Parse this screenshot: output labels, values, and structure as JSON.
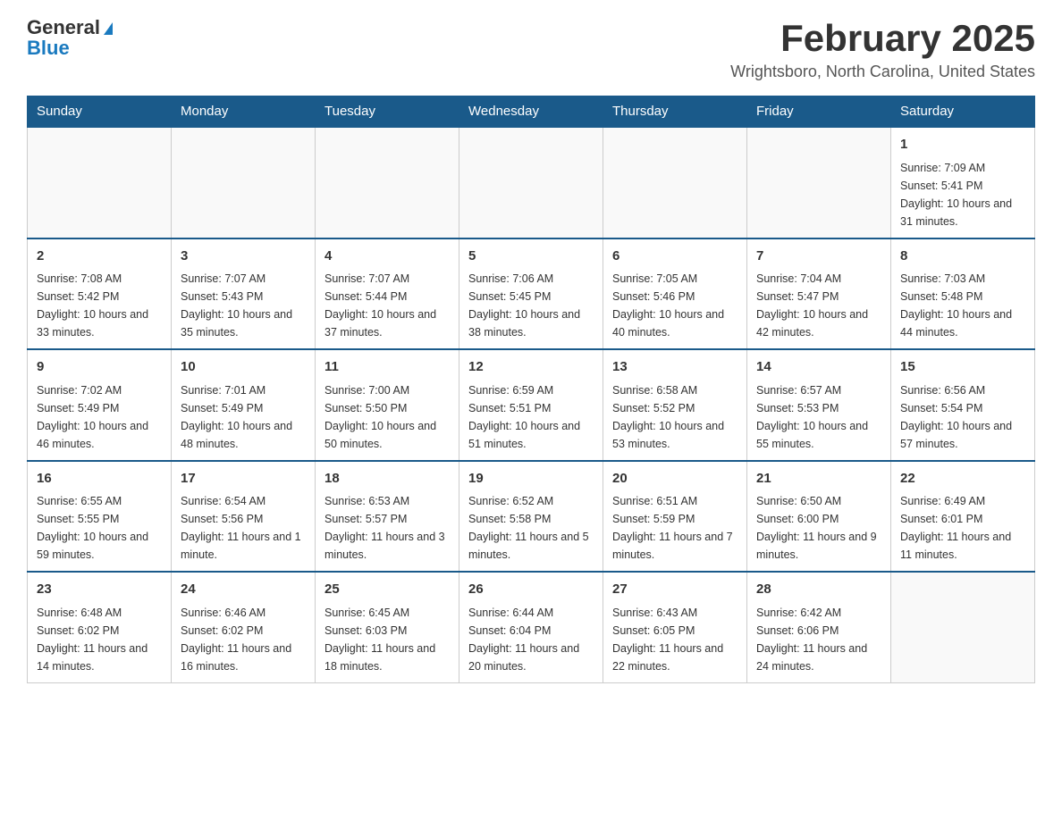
{
  "logo": {
    "general": "General",
    "blue": "Blue"
  },
  "header": {
    "month": "February 2025",
    "location": "Wrightsboro, North Carolina, United States"
  },
  "weekdays": [
    "Sunday",
    "Monday",
    "Tuesday",
    "Wednesday",
    "Thursday",
    "Friday",
    "Saturday"
  ],
  "weeks": [
    [
      {
        "day": "",
        "sunrise": "",
        "sunset": "",
        "daylight": ""
      },
      {
        "day": "",
        "sunrise": "",
        "sunset": "",
        "daylight": ""
      },
      {
        "day": "",
        "sunrise": "",
        "sunset": "",
        "daylight": ""
      },
      {
        "day": "",
        "sunrise": "",
        "sunset": "",
        "daylight": ""
      },
      {
        "day": "",
        "sunrise": "",
        "sunset": "",
        "daylight": ""
      },
      {
        "day": "",
        "sunrise": "",
        "sunset": "",
        "daylight": ""
      },
      {
        "day": "1",
        "sunrise": "Sunrise: 7:09 AM",
        "sunset": "Sunset: 5:41 PM",
        "daylight": "Daylight: 10 hours and 31 minutes."
      }
    ],
    [
      {
        "day": "2",
        "sunrise": "Sunrise: 7:08 AM",
        "sunset": "Sunset: 5:42 PM",
        "daylight": "Daylight: 10 hours and 33 minutes."
      },
      {
        "day": "3",
        "sunrise": "Sunrise: 7:07 AM",
        "sunset": "Sunset: 5:43 PM",
        "daylight": "Daylight: 10 hours and 35 minutes."
      },
      {
        "day": "4",
        "sunrise": "Sunrise: 7:07 AM",
        "sunset": "Sunset: 5:44 PM",
        "daylight": "Daylight: 10 hours and 37 minutes."
      },
      {
        "day": "5",
        "sunrise": "Sunrise: 7:06 AM",
        "sunset": "Sunset: 5:45 PM",
        "daylight": "Daylight: 10 hours and 38 minutes."
      },
      {
        "day": "6",
        "sunrise": "Sunrise: 7:05 AM",
        "sunset": "Sunset: 5:46 PM",
        "daylight": "Daylight: 10 hours and 40 minutes."
      },
      {
        "day": "7",
        "sunrise": "Sunrise: 7:04 AM",
        "sunset": "Sunset: 5:47 PM",
        "daylight": "Daylight: 10 hours and 42 minutes."
      },
      {
        "day": "8",
        "sunrise": "Sunrise: 7:03 AM",
        "sunset": "Sunset: 5:48 PM",
        "daylight": "Daylight: 10 hours and 44 minutes."
      }
    ],
    [
      {
        "day": "9",
        "sunrise": "Sunrise: 7:02 AM",
        "sunset": "Sunset: 5:49 PM",
        "daylight": "Daylight: 10 hours and 46 minutes."
      },
      {
        "day": "10",
        "sunrise": "Sunrise: 7:01 AM",
        "sunset": "Sunset: 5:49 PM",
        "daylight": "Daylight: 10 hours and 48 minutes."
      },
      {
        "day": "11",
        "sunrise": "Sunrise: 7:00 AM",
        "sunset": "Sunset: 5:50 PM",
        "daylight": "Daylight: 10 hours and 50 minutes."
      },
      {
        "day": "12",
        "sunrise": "Sunrise: 6:59 AM",
        "sunset": "Sunset: 5:51 PM",
        "daylight": "Daylight: 10 hours and 51 minutes."
      },
      {
        "day": "13",
        "sunrise": "Sunrise: 6:58 AM",
        "sunset": "Sunset: 5:52 PM",
        "daylight": "Daylight: 10 hours and 53 minutes."
      },
      {
        "day": "14",
        "sunrise": "Sunrise: 6:57 AM",
        "sunset": "Sunset: 5:53 PM",
        "daylight": "Daylight: 10 hours and 55 minutes."
      },
      {
        "day": "15",
        "sunrise": "Sunrise: 6:56 AM",
        "sunset": "Sunset: 5:54 PM",
        "daylight": "Daylight: 10 hours and 57 minutes."
      }
    ],
    [
      {
        "day": "16",
        "sunrise": "Sunrise: 6:55 AM",
        "sunset": "Sunset: 5:55 PM",
        "daylight": "Daylight: 10 hours and 59 minutes."
      },
      {
        "day": "17",
        "sunrise": "Sunrise: 6:54 AM",
        "sunset": "Sunset: 5:56 PM",
        "daylight": "Daylight: 11 hours and 1 minute."
      },
      {
        "day": "18",
        "sunrise": "Sunrise: 6:53 AM",
        "sunset": "Sunset: 5:57 PM",
        "daylight": "Daylight: 11 hours and 3 minutes."
      },
      {
        "day": "19",
        "sunrise": "Sunrise: 6:52 AM",
        "sunset": "Sunset: 5:58 PM",
        "daylight": "Daylight: 11 hours and 5 minutes."
      },
      {
        "day": "20",
        "sunrise": "Sunrise: 6:51 AM",
        "sunset": "Sunset: 5:59 PM",
        "daylight": "Daylight: 11 hours and 7 minutes."
      },
      {
        "day": "21",
        "sunrise": "Sunrise: 6:50 AM",
        "sunset": "Sunset: 6:00 PM",
        "daylight": "Daylight: 11 hours and 9 minutes."
      },
      {
        "day": "22",
        "sunrise": "Sunrise: 6:49 AM",
        "sunset": "Sunset: 6:01 PM",
        "daylight": "Daylight: 11 hours and 11 minutes."
      }
    ],
    [
      {
        "day": "23",
        "sunrise": "Sunrise: 6:48 AM",
        "sunset": "Sunset: 6:02 PM",
        "daylight": "Daylight: 11 hours and 14 minutes."
      },
      {
        "day": "24",
        "sunrise": "Sunrise: 6:46 AM",
        "sunset": "Sunset: 6:02 PM",
        "daylight": "Daylight: 11 hours and 16 minutes."
      },
      {
        "day": "25",
        "sunrise": "Sunrise: 6:45 AM",
        "sunset": "Sunset: 6:03 PM",
        "daylight": "Daylight: 11 hours and 18 minutes."
      },
      {
        "day": "26",
        "sunrise": "Sunrise: 6:44 AM",
        "sunset": "Sunset: 6:04 PM",
        "daylight": "Daylight: 11 hours and 20 minutes."
      },
      {
        "day": "27",
        "sunrise": "Sunrise: 6:43 AM",
        "sunset": "Sunset: 6:05 PM",
        "daylight": "Daylight: 11 hours and 22 minutes."
      },
      {
        "day": "28",
        "sunrise": "Sunrise: 6:42 AM",
        "sunset": "Sunset: 6:06 PM",
        "daylight": "Daylight: 11 hours and 24 minutes."
      },
      {
        "day": "",
        "sunrise": "",
        "sunset": "",
        "daylight": ""
      }
    ]
  ]
}
